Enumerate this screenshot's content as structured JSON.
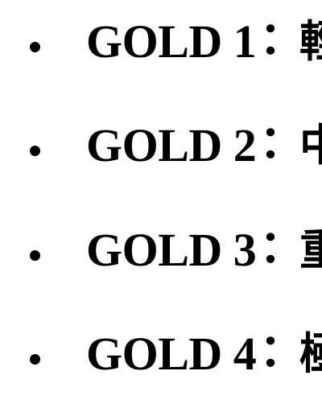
{
  "items": [
    {
      "label": "GOLD 1",
      "separator": "：",
      "text": "輕"
    },
    {
      "label": "GOLD 2",
      "separator": "：",
      "text": "中"
    },
    {
      "label": "GOLD 3",
      "separator": "：",
      "text": "重"
    },
    {
      "label": "GOLD 4",
      "separator": "：",
      "text": "極"
    }
  ]
}
